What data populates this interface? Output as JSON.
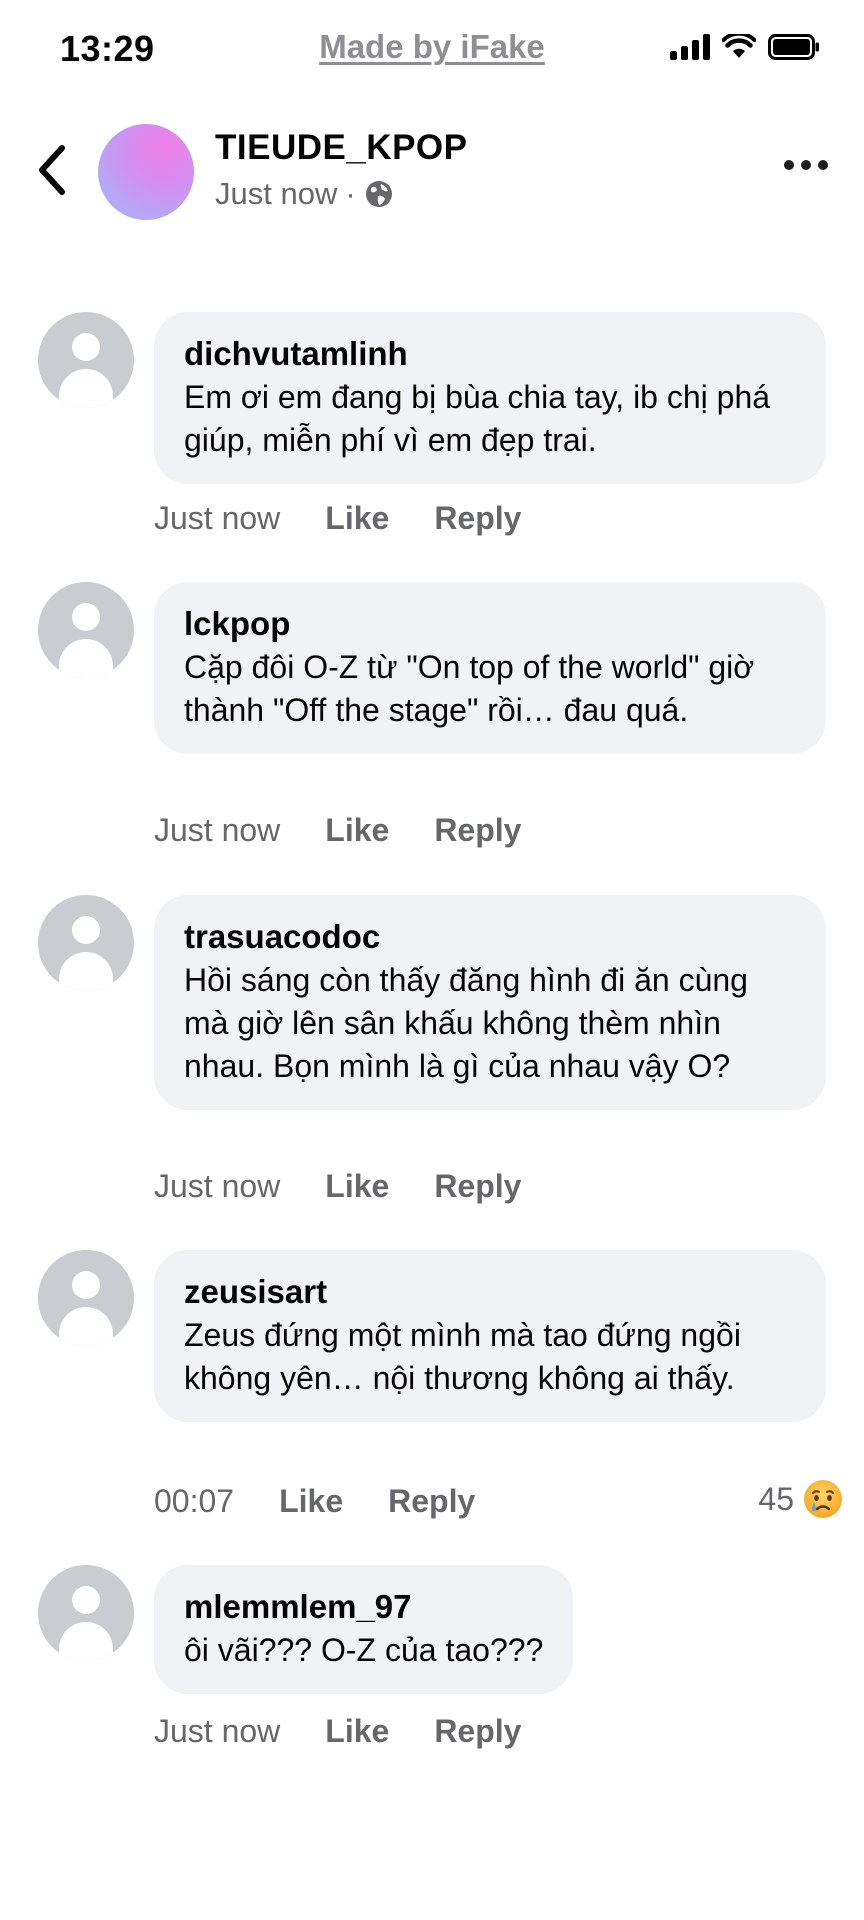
{
  "status_bar": {
    "time": "13:29",
    "watermark": "Made by iFake",
    "icons": [
      "signal-icon",
      "wifi-icon",
      "battery-icon"
    ]
  },
  "header": {
    "page_name": "TIEUDE_KPOP",
    "meta_time": "Just now",
    "meta_separator": "·",
    "icons": [
      "back-chevron-icon",
      "globe-icon",
      "more-dots-icon"
    ]
  },
  "action_labels": {
    "like": "Like",
    "reply": "Reply"
  },
  "comments": [
    {
      "author": "dichvutamlinh",
      "text": "Em ơi em đang bị bùa chia tay, ib chị phá giúp, miễn phí vì em đẹp trai.",
      "time": "Just now"
    },
    {
      "author": "lckpop",
      "text": "Cặp đôi O-Z từ \"On top of the world\" giờ thành \"Off the stage\" rồi… đau quá.",
      "time": "Just now"
    },
    {
      "author": "trasuacodoc",
      "text": "Hồi sáng còn thấy đăng hình đi ăn cùng mà giờ lên sân khấu không thèm nhìn nhau. Bọn mình là gì của nhau vậy O?",
      "time": "Just now"
    },
    {
      "author": "zeusisart",
      "text": "Zeus đứng một mình mà tao đứng ngồi không yên… nội thương không ai thấy.",
      "time": "00:07",
      "reaction_count": "45",
      "reaction_icon": "sad-emoji-icon"
    },
    {
      "author": "mlemmlem_97",
      "text": "ôi vãi??? O-Z của tao???",
      "time": "Just now"
    }
  ],
  "colors": {
    "bubble_bg": "#f0f2f5",
    "secondary_text": "#65676b",
    "avatar_placeholder": "#c9ccd1",
    "watermark": "#8e8e93"
  }
}
